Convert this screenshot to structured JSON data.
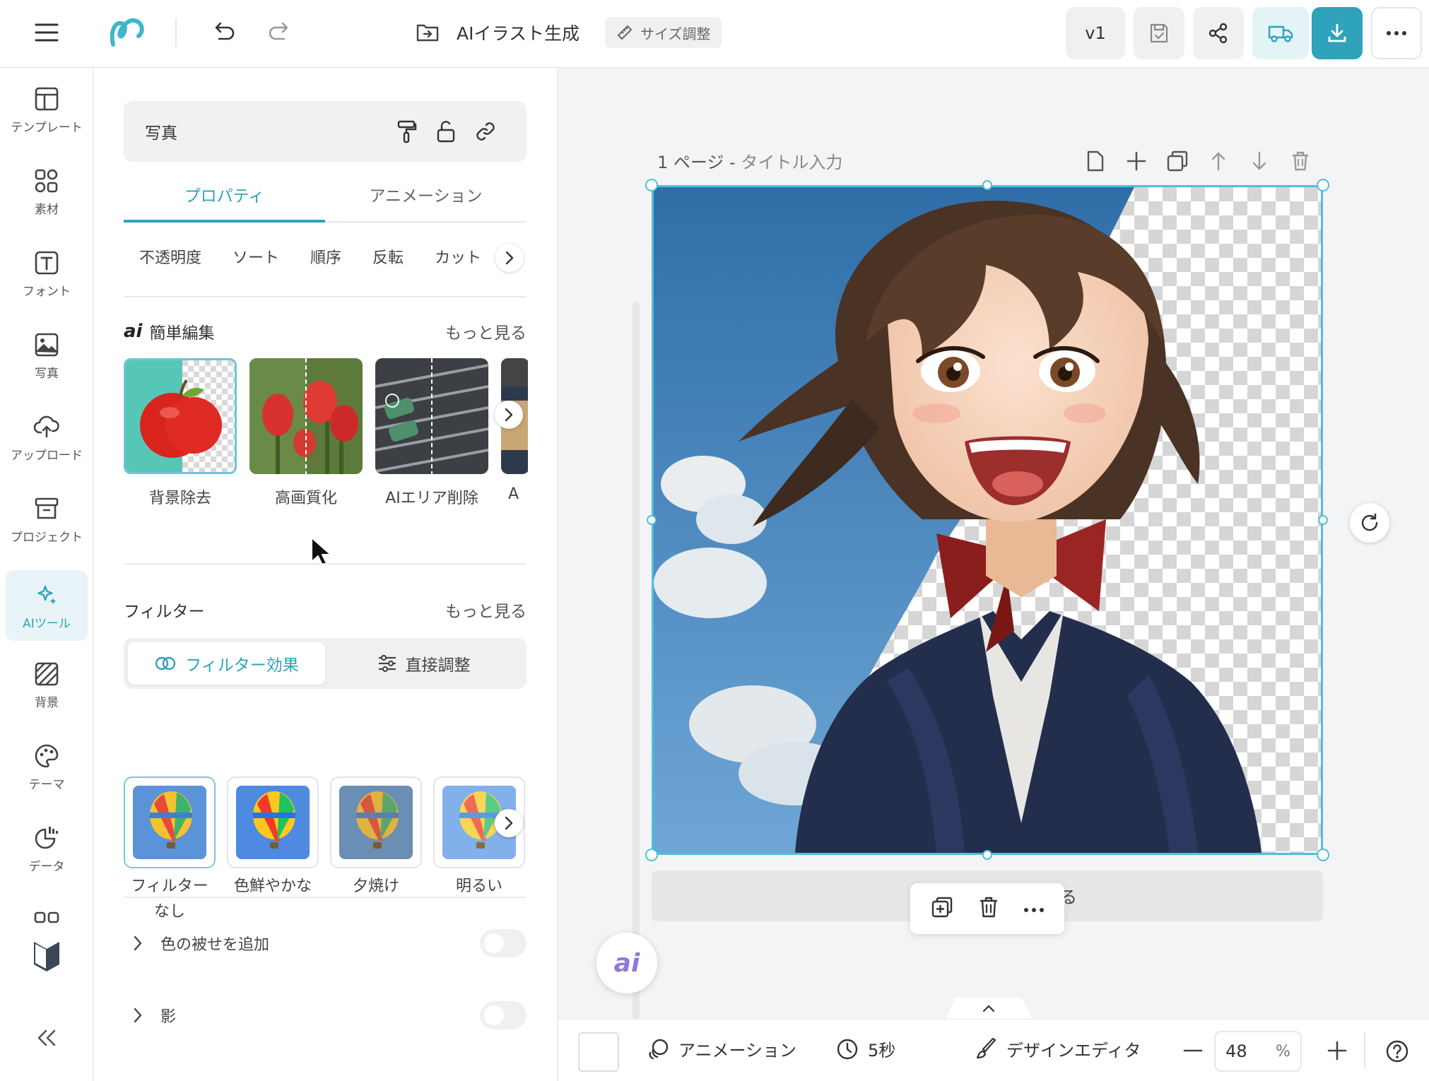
{
  "topbar": {
    "title": "AIイラスト生成",
    "resize_label": "サイズ調整",
    "version_label": "v1"
  },
  "rail": [
    {
      "label": "テンプレート",
      "icon": "template-icon"
    },
    {
      "label": "素材",
      "icon": "elements-icon"
    },
    {
      "label": "フォント",
      "icon": "font-icon"
    },
    {
      "label": "写真",
      "icon": "photo-icon"
    },
    {
      "label": "アップロード",
      "icon": "upload-icon"
    },
    {
      "label": "プロジェクト",
      "icon": "project-icon"
    },
    {
      "label": "AIツール",
      "icon": "ai-tools-icon",
      "active": true
    },
    {
      "label": "背景",
      "icon": "background-icon"
    },
    {
      "label": "テーマ",
      "icon": "theme-icon"
    },
    {
      "label": "データ",
      "icon": "data-icon"
    }
  ],
  "panel": {
    "header_label": "写真",
    "tabs": [
      "プロパティ",
      "アニメーション"
    ],
    "subtabs": [
      "不透明度",
      "ソート",
      "順序",
      "反転",
      "カット"
    ],
    "quick_edit": {
      "title": "簡単編集",
      "more": "もっと見る",
      "items": [
        "背景除去",
        "高画質化",
        "AIエリア削除",
        "A"
      ]
    },
    "filter": {
      "title": "フィルター",
      "more": "もっと見る",
      "segments": [
        "フィルター効果",
        "直接調整"
      ],
      "items": [
        "フィルター\nなし",
        "色鮮やかな",
        "夕焼け",
        "明るい"
      ]
    },
    "toggles": [
      {
        "label": "色の被せを追加",
        "on": false
      },
      {
        "label": "影",
        "on": false
      }
    ]
  },
  "canvas": {
    "page_number": "1 ページ - ",
    "page_title_placeholder": "タイトル入力",
    "note_partial": "る"
  },
  "ai_button": "ai",
  "bottombar": {
    "animation_label": "アニメーション",
    "duration": "5秒",
    "editor_label": "デザインエディタ",
    "zoom_value": "48",
    "zoom_unit": "%"
  },
  "colors": {
    "accent": "#2fa3ba",
    "selection": "#4ec0d6"
  }
}
